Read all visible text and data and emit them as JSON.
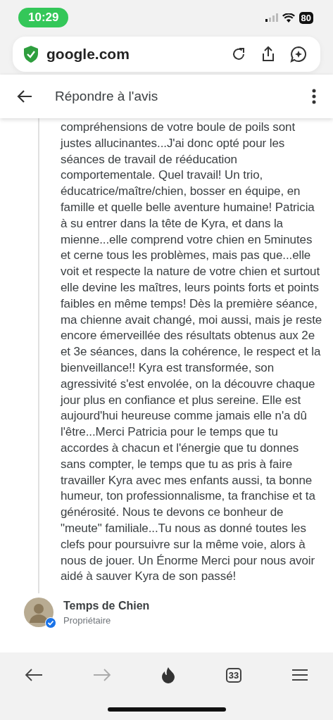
{
  "status_bar": {
    "time": "10:29",
    "battery": "80"
  },
  "address_bar": {
    "url": "google.com"
  },
  "header": {
    "title": "Répondre à l'avis"
  },
  "review": {
    "text": "compréhensions de votre boule de poils sont justes allucinantes...J'ai donc opté pour les séances de travail de rééducation comportementale. Quel travail! Un trio, éducatrice/maître/chien, bosser en équipe, en famille et quelle belle aventure humaine! Patricia à su entrer dans la tête de Kyra, et dans la mienne...elle comprend votre chien en 5minutes et cerne tous les problèmes, mais pas que...elle voit et respecte la nature de votre chien et surtout elle devine les maîtres, leurs points forts et points faibles en même temps! Dès la première séance, ma chienne avait changé, moi aussi, mais je reste encore émerveillée des résultats obtenus aux 2e et 3e séances, dans la cohérence, le respect et la bienveillance!! Kyra est transformée, son agressivité s'est envolée, on la découvre chaque jour plus en confiance et plus sereine. Elle est aujourd'hui heureuse comme jamais elle n'a dû l'être...Merci Patricia pour le temps que tu accordes à chacun et l'énergie que tu donnes sans compter, le temps que tu as pris à faire travailler Kyra avec mes enfants aussi, ta bonne humeur, ton professionnalisme, ta franchise et ta générosité. Nous te devons ce bonheur de \"meute\" familiale...Tu nous as donné toutes les clefs pour poursuivre sur la même voie, alors à nous de jouer. Un Énorme Merci pour nous avoir aidé à sauver Kyra de son passé!"
  },
  "owner": {
    "name": "Temps de Chien",
    "role": "Propriétaire",
    "verified": true
  },
  "toolbar": {
    "tab_count": "33",
    "forward_disabled": true
  }
}
